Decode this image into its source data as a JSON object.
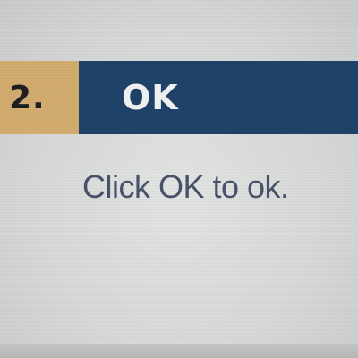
{
  "step": {
    "number": "2.",
    "title": "OK"
  },
  "instruction": {
    "text": "Click OK to ok."
  },
  "colors": {
    "number_box": "#d2ac6e",
    "title_box": "#1f4268",
    "title_text": "#f1f1f1",
    "instruction_text": "#47536a",
    "background": "#d9dbda"
  }
}
